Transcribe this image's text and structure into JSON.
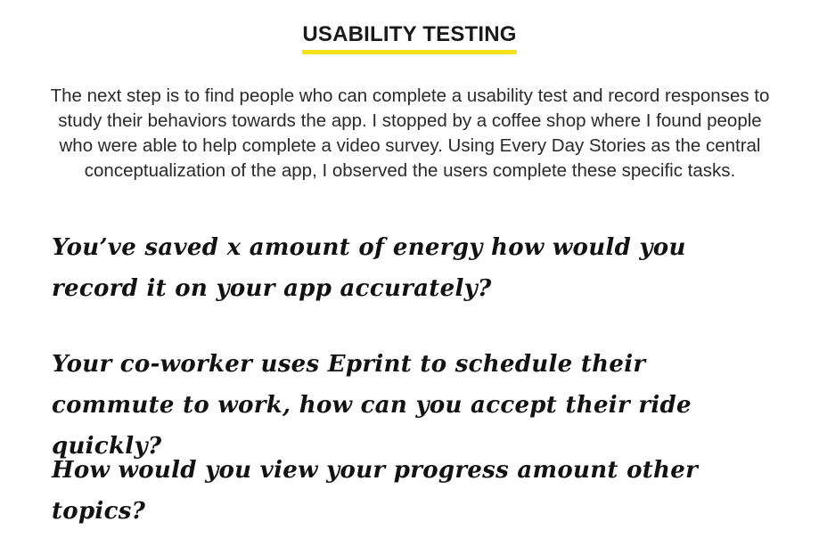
{
  "section": {
    "title": "USABILITY TESTING",
    "intro": "The next step is to find people who can complete a usability test and record responses to study their behaviors towards the app. I stopped by a coffee shop where I found people who were able to help complete a video survey. Using Every Day Stories as the central conceptualization of the app, I observed the users complete these specific tasks."
  },
  "tasks": [
    "You’ve saved x amount of energy how would you record it on your app accurately?",
    "Your co-worker uses Eprint to schedule their commute to work, how can you accept their ride quickly?",
    "How would you view your progress amount other topics?"
  ],
  "colors": {
    "accent_underline": "#f5e11a",
    "text": "#1a1a1a",
    "background": "#ffffff"
  }
}
